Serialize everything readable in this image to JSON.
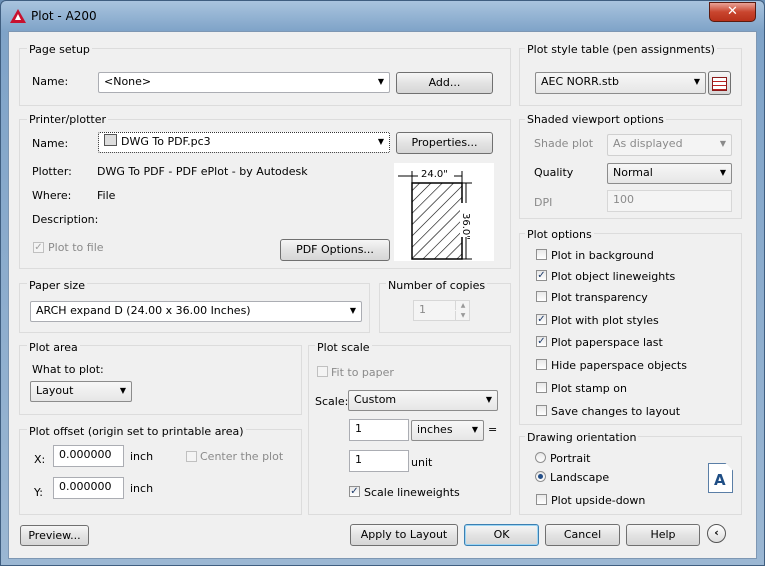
{
  "window": {
    "title": "Plot - A200",
    "close_label": "✕"
  },
  "page_setup": {
    "group_label": "Page setup",
    "name_label": "Name:",
    "name_value": "<None>",
    "add_button": "Add..."
  },
  "printer": {
    "group_label": "Printer/plotter",
    "name_label": "Name:",
    "name_value": "DWG To PDF.pc3",
    "properties_button": "Properties...",
    "plotter_label": "Plotter:",
    "plotter_value": "DWG To PDF - PDF ePlot - by Autodesk",
    "where_label": "Where:",
    "where_value": "File",
    "description_label": "Description:",
    "plot_to_file_label": "Plot to file",
    "pdf_options_button": "PDF Options...",
    "preview_width": "24.0\"",
    "preview_height": "36.0\""
  },
  "paper_size": {
    "group_label": "Paper size",
    "value": "ARCH expand D (24.00 x 36.00 Inches)"
  },
  "copies": {
    "group_label": "Number of copies",
    "value": "1"
  },
  "plot_area": {
    "group_label": "Plot area",
    "what_label": "What to plot:",
    "what_value": "Layout"
  },
  "plot_offset": {
    "group_label": "Plot offset (origin set to printable area)",
    "x_label": "X:",
    "x_value": "0.000000",
    "x_unit": "inch",
    "y_label": "Y:",
    "y_value": "0.000000",
    "y_unit": "inch",
    "center_label": "Center the plot"
  },
  "plot_scale": {
    "group_label": "Plot scale",
    "fit_label": "Fit to paper",
    "scale_label": "Scale:",
    "scale_value": "Custom",
    "value1": "1",
    "unit_value": "inches",
    "equals": "=",
    "value2": "1",
    "unit_label": "unit",
    "lineweights_label": "Scale lineweights"
  },
  "plot_style": {
    "group_label": "Plot style table (pen assignments)",
    "value": "AEC NORR.stb"
  },
  "shaded": {
    "group_label": "Shaded viewport options",
    "shade_label": "Shade plot",
    "shade_value": "As displayed",
    "quality_label": "Quality",
    "quality_value": "Normal",
    "dpi_label": "DPI",
    "dpi_value": "100"
  },
  "plot_options": {
    "group_label": "Plot options",
    "items": [
      {
        "label": "Plot in background",
        "mark": ""
      },
      {
        "label": "Plot object lineweights",
        "mark": "✓"
      },
      {
        "label": "Plot transparency",
        "mark": ""
      },
      {
        "label": "Plot with plot styles",
        "mark": "✓"
      },
      {
        "label": "Plot paperspace last",
        "mark": "✓"
      },
      {
        "label": "Hide paperspace objects",
        "mark": ""
      },
      {
        "label": "Plot stamp on",
        "mark": ""
      },
      {
        "label": "Save changes to layout",
        "mark": ""
      }
    ]
  },
  "orientation": {
    "group_label": "Drawing orientation",
    "portrait_label": "Portrait",
    "landscape_label": "Landscape",
    "selected": "Landscape",
    "upside_down_label": "Plot upside-down",
    "icon_letter": "A"
  },
  "footer": {
    "preview": "Preview...",
    "apply": "Apply to Layout",
    "ok": "OK",
    "cancel": "Cancel",
    "help": "Help"
  },
  "checks": {
    "plot_to_file": "✓",
    "scale_lineweights": "✓",
    "fit": "",
    "center": ""
  }
}
